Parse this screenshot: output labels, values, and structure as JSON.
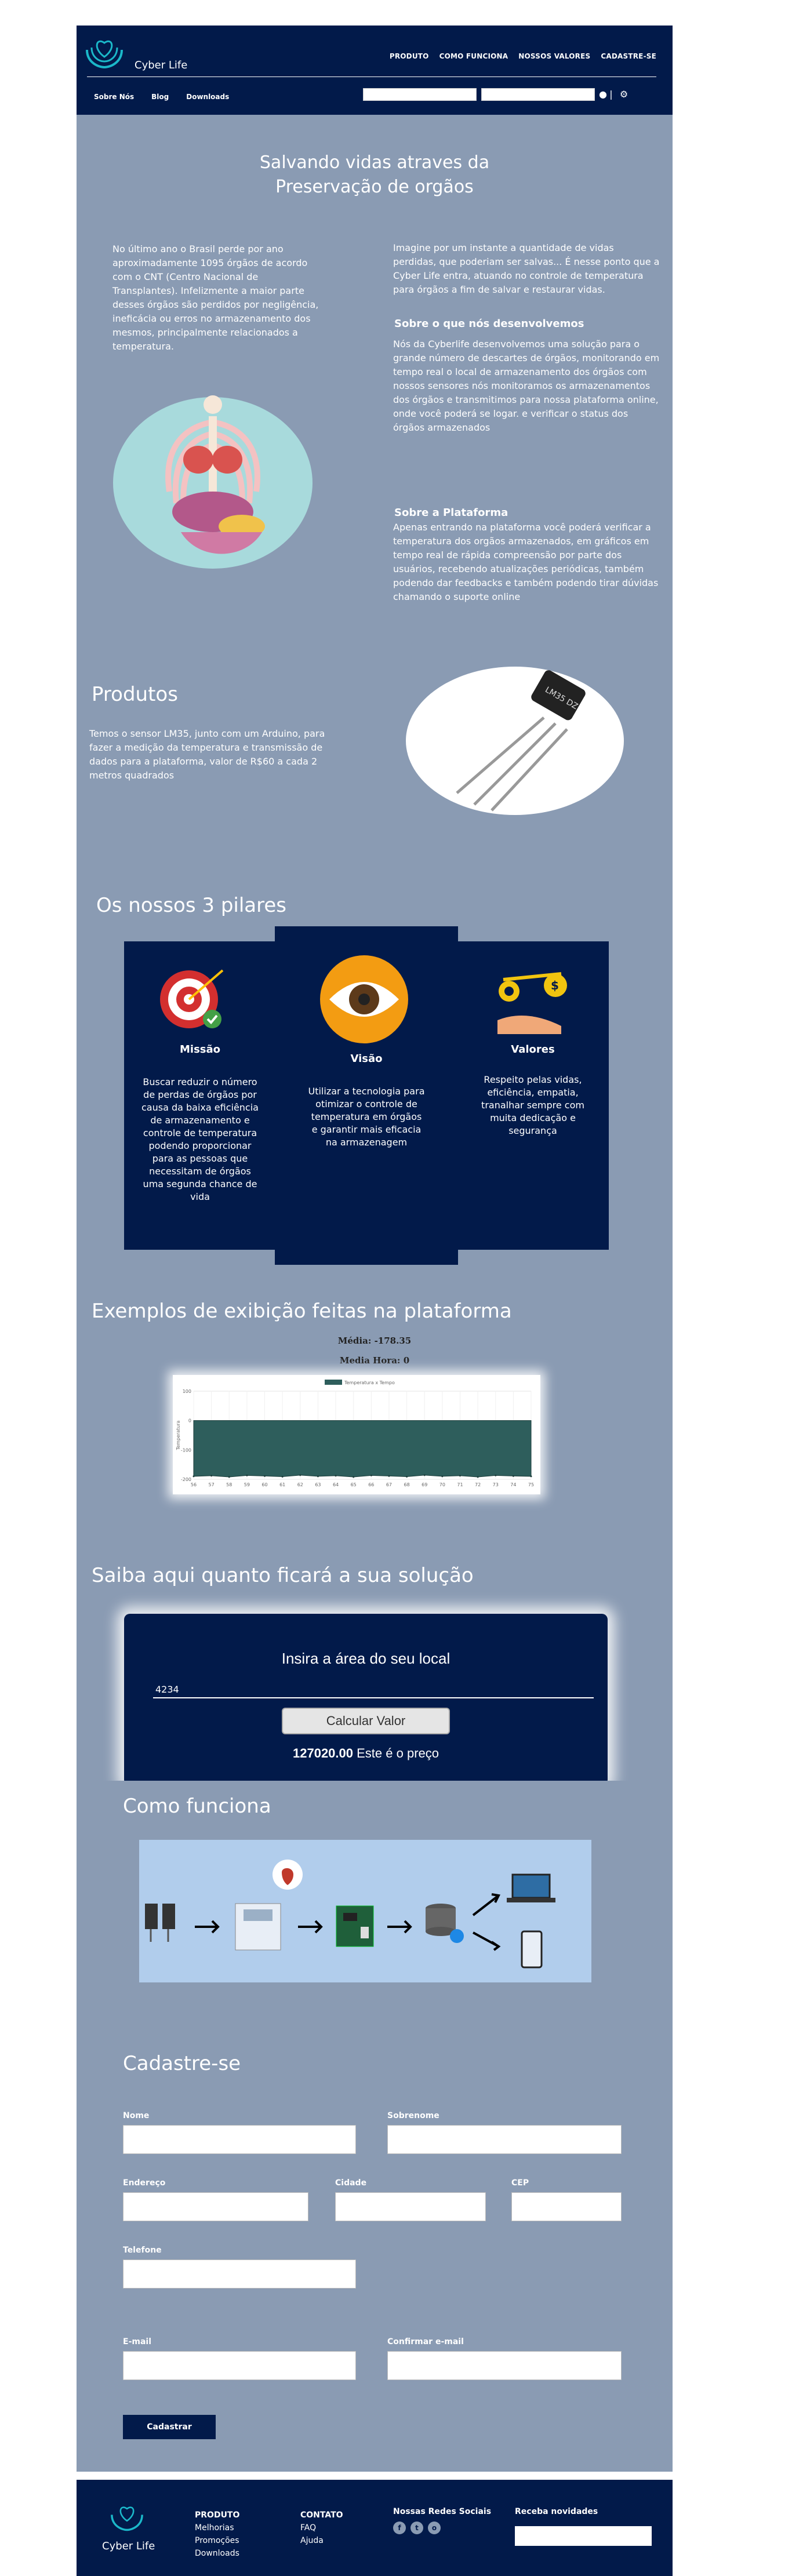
{
  "header": {
    "brand": "Cyber Life",
    "nav": [
      "PRODUTO",
      "COMO FUNCIONA",
      "NOSSOS VALORES",
      "CADASTRE-SE"
    ],
    "subnav": [
      "Sobre Nós",
      "Blog",
      "Downloads"
    ],
    "icons": [
      "user-icon",
      "gear-icon"
    ]
  },
  "intro": {
    "title": "Salvando vidas atraves da Preservação de orgãos",
    "left": "No último ano o Brasil perde por ano aproximadamente 1095 órgãos de acordo com o CNT (Centro Nacional de Transplantes). Infelizmente a maior parte desses órgãos são perdidos por negligência, ineficácia ou erros no armazenamento dos mesmos, principalmente relacionados a temperatura.",
    "right1": "Imagine por um instante a quantidade de vidas perdidas, que poderiam ser salvas... É nesse ponto que a Cyber Life entra, atuando no controle de temperatura para órgãos a fim de salvar e restaurar vidas.",
    "h_dev": "Sobre o que nós desenvolvemos",
    "dev": "Nós da Cyberlife desenvolvemos uma solução para o grande número de descartes de órgãos, monitorando em tempo real o local de armazenamento dos órgãos com nossos sensores nós monitoramos os armazenamentos dos órgãos e transmitimos para nossa plataforma online, onde você poderá se logar. e verificar o status dos órgãos armazenados",
    "h_plat": "Sobre a Plataforma",
    "plat": "Apenas entrando na plataforma você poderá verificar a temperatura dos orgãos armazenados, em gráficos em tempo real de rápida compreensão por parte dos usuários, recebendo atualizações periódicas, também podendo dar feedbacks e também podendo tirar dúvidas chamando o suporte online"
  },
  "produtos": {
    "title": "Produtos",
    "text": "Temos o sensor LM35, junto com um Arduino, para fazer a medição da temperatura e transmissão de dados para a plataforma, valor de R$60 a cada 2 metros quadrados",
    "sensor_label": "LM35 DZ"
  },
  "pilares": {
    "title": "Os nossos 3 pilares",
    "cards": [
      {
        "title": "Missão",
        "text": "Buscar reduzir o número de perdas de órgãos por causa da baixa eficiência de armazenamento e controle de temperatura podendo proporcionar para as pessoas que necessitam de órgãos uma segunda chance de vida"
      },
      {
        "title": "Visão",
        "text": "Utilizar a tecnologia para otimizar o controle de temperatura em órgãos e garantir mais eficacia na armazenagem"
      },
      {
        "title": "Valores",
        "text": "Respeito pelas vidas, eficiência, empatia, tranalhar sempre com muita dedicação e segurança"
      }
    ]
  },
  "exemplos": {
    "title": "Exemplos de exibição feitas na plataforma",
    "media": "Média: -178.35",
    "media_hora": "Media Hora: 0"
  },
  "chart_data": {
    "type": "area",
    "title": "",
    "legend": [
      "Temperatura x Tempo"
    ],
    "xlabel": "",
    "ylabel": "Temperatura",
    "x": [
      "56",
      "57",
      "58",
      "59",
      "60",
      "61",
      "62",
      "63",
      "64",
      "65",
      "66",
      "67",
      "68",
      "69",
      "70",
      "71",
      "72",
      "73",
      "74",
      "75"
    ],
    "series": [
      {
        "name": "Temperatura x Tempo",
        "values": [
          -190,
          -188,
          -192,
          -187,
          -189,
          -191,
          -186,
          -190,
          -188,
          -192,
          -187,
          -189,
          -191,
          -186,
          -190,
          -188,
          -192,
          -187,
          -189,
          -190
        ]
      }
    ],
    "ylim": [
      -200,
      100
    ],
    "yticks": [
      "100",
      "0",
      "-100",
      "-200"
    ],
    "color": "#2e5e5c"
  },
  "calculadora": {
    "title": "Saiba aqui quanto ficará a sua solução",
    "box_title": "Insira a área do seu local",
    "input_value": "4234",
    "button": "Calcular Valor",
    "result_value": "127020.00",
    "result_text": "Este é o preço"
  },
  "como": {
    "title": "Como funciona"
  },
  "cadastro": {
    "title": "Cadastre-se",
    "labels": {
      "nome": "Nome",
      "sobrenome": "Sobrenome",
      "endereco": "Endereço",
      "cidade": "Cidade",
      "cep": "CEP",
      "telefone": "Telefone",
      "email": "E-mail",
      "confirmar": "Confirmar e-mail"
    },
    "button": "Cadastrar"
  },
  "footer": {
    "brand": "Cyber Life",
    "produto_h": "PRODUTO",
    "produto": [
      "Melhorias",
      "Promoções",
      "Downloads"
    ],
    "contato_h": "CONTATO",
    "contato": [
      "FAQ",
      "Ajuda"
    ],
    "redes": "Nossas Redes Sociais",
    "novidades": "Receba novidades"
  },
  "colors": {
    "navy": "#021a4a",
    "section": "#8a9bb3",
    "accent": "#1bb8c9"
  }
}
